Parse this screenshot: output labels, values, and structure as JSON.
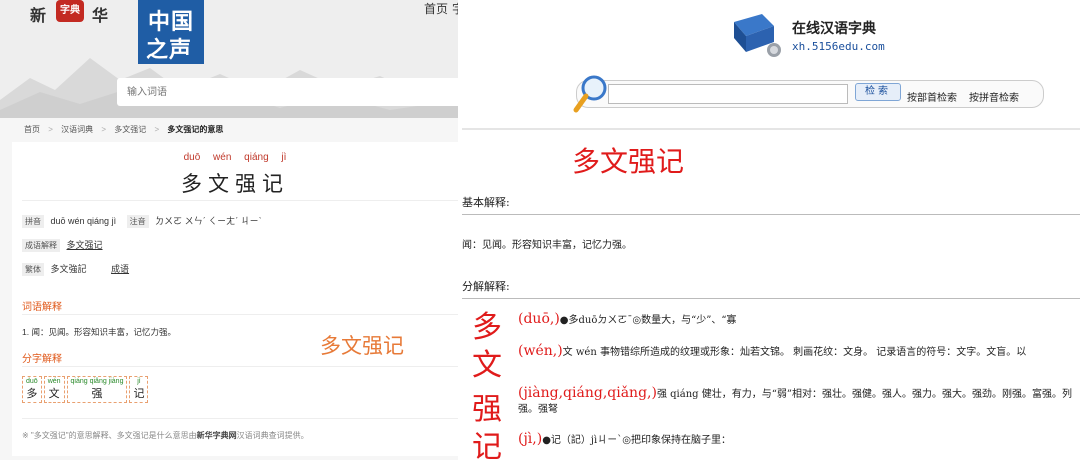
{
  "left": {
    "brand": {
      "char_a": "新",
      "seal": "字典",
      "char_c": "华"
    },
    "logo": {
      "line1": "中国",
      "line2": "之声"
    },
    "nav": {
      "home": "首页",
      "next": "字"
    },
    "search": {
      "placeholder": "输入词语"
    },
    "breadcrumb": [
      "首页",
      "汉语词典",
      "多文强记",
      "多文强记的意思"
    ],
    "breadcrumb_sep": ">",
    "word": {
      "pinyin": "duō wén qiáng jì",
      "text": "多文强记"
    },
    "meta": {
      "pinyin_tag": "拼音",
      "pinyin_value": "duō wén qiáng jì",
      "zhuyin_tag": "注音",
      "zhuyin_value": "ㄉㄨㄛ ㄨㄣˊ ㄑㄧㄤˊ ㄐㄧˋ",
      "idiom_tag": "成语解释",
      "idiom_value": "多文强记",
      "trad_tag": "繁体",
      "trad_value": "多文強記",
      "trad_extra": "成语"
    },
    "sections": {
      "word_expl": "词语解释",
      "char_expl": "分字解释"
    },
    "definition": "1. 闻：见闻。形容知识丰富，记忆力强。",
    "watermark": "多文强记",
    "chars": [
      {
        "py": "duō",
        "hz": "多"
      },
      {
        "py": "wén",
        "hz": "文"
      },
      {
        "py": "qiáng qiǎng jiàng",
        "hz": "强"
      },
      {
        "py": "jì",
        "hz": "记"
      }
    ],
    "footnote": {
      "pre": "※ \"多文强记\"的意思解释、多文强记是什么意思由",
      "bold": "新华字典网",
      "post": "汉语词典查词提供。"
    }
  },
  "right": {
    "site_name": "在线汉语字典",
    "site_url": "xh.5156edu.com",
    "search_button": "检索",
    "radical_link": "按部首检索",
    "pinyin_link": "按拼音检索",
    "title": "多文强记",
    "basic_section": "基本解释:",
    "basic_def": "闻：见闻。形容知识丰富，记忆力强。",
    "detail_section": "分解解释:",
    "entries": [
      {
        "char": "多",
        "py": "(duō,)",
        "text": "●多duōㄉㄨㄛˉ◎数量大，与“少”、“寡"
      },
      {
        "char": "文",
        "py": "(wén,)",
        "text": "文 wén 事物错综所造成的纹理或形象：灿若文锦。 刺画花纹：文身。 记录语言的符号：文字。文盲。以"
      },
      {
        "char": "强",
        "py": "(jiàng,qiáng,qiǎng,)",
        "text": "强 qiáng 健壮，有力，与“弱”相对：强壮。强健。强人。强力。强大。强劲。刚强。富强。列强。强弩"
      },
      {
        "char": "记",
        "py": "(jì,)",
        "text": "●记（記）jìㄐㄧˋ◎把印象保持在脑子里："
      }
    ]
  },
  "colors": {
    "accent_red": "#e01b1b",
    "accent_orange": "#e05a1c",
    "link_blue": "#1a4f9c",
    "logo_blue": "#1f5da5"
  }
}
